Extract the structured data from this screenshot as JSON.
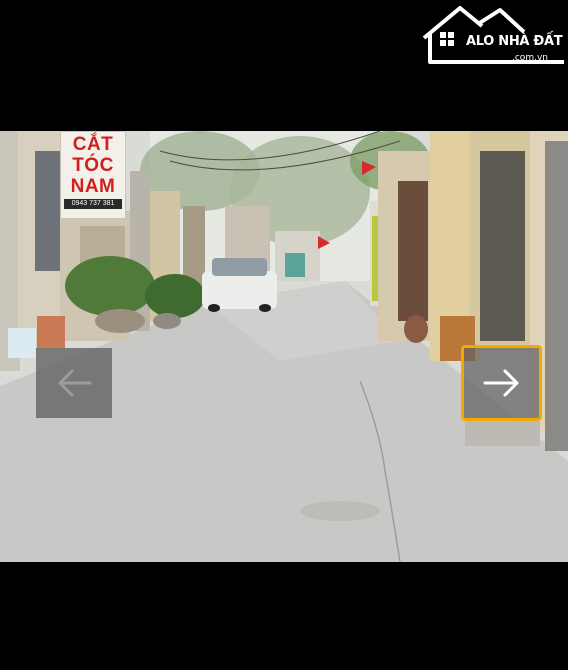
{
  "watermark": {
    "brand": "ALO NHÀ ĐẤT",
    "domain": ".com.vn",
    "icon": "house-logo-icon",
    "color": "#ffffff"
  },
  "photo": {
    "sign": {
      "line1": "CẮT",
      "line2": "TÓC",
      "line3": "NAM",
      "phone": "0943 737 381",
      "color": "#d11f1f"
    }
  },
  "navigation": {
    "prev_icon": "arrow-left-icon",
    "next_icon": "arrow-right-icon",
    "active_border_color": "#f2a900"
  }
}
